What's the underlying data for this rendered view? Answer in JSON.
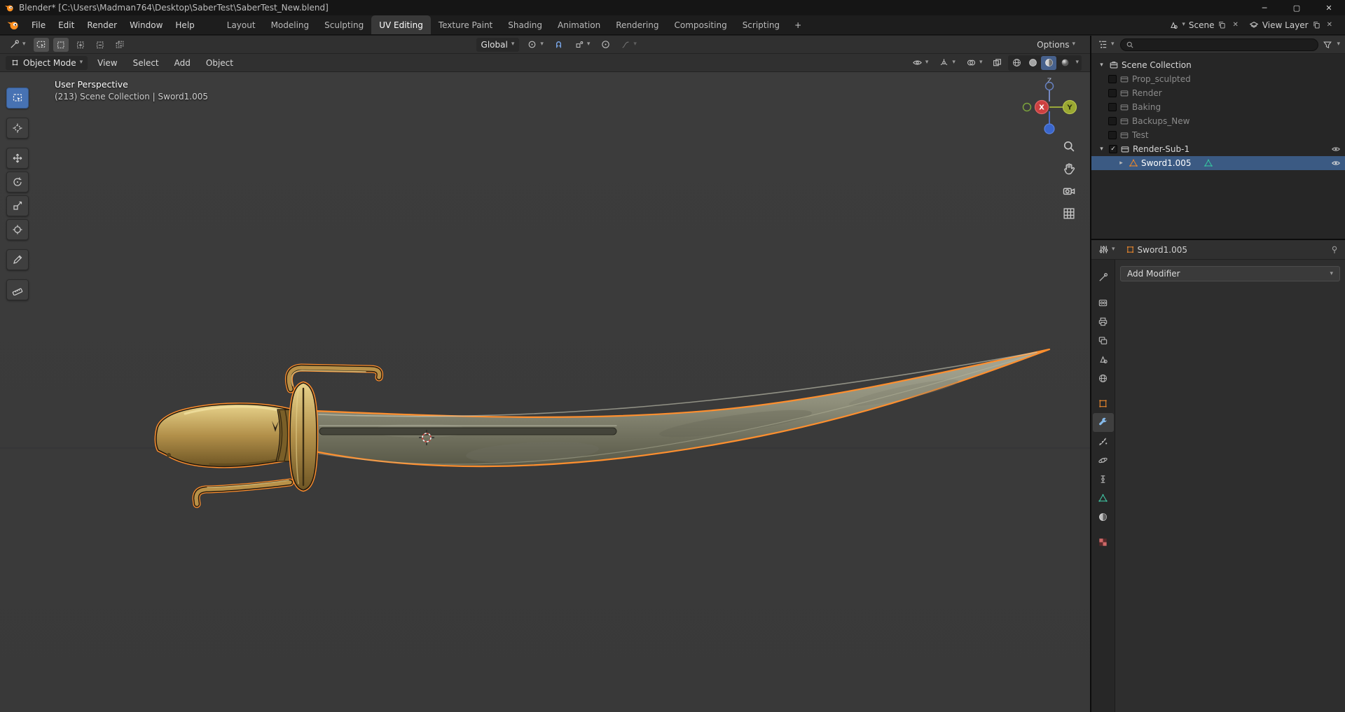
{
  "window": {
    "title": "Blender* [C:\\Users\\Madman764\\Desktop\\SaberTest\\SaberTest_New.blend]",
    "controls": [
      "minimize",
      "maximize",
      "close"
    ]
  },
  "topbar": {
    "menus": [
      "File",
      "Edit",
      "Render",
      "Window",
      "Help"
    ],
    "workspaces": [
      "Layout",
      "Modeling",
      "Sculpting",
      "UV Editing",
      "Texture Paint",
      "Shading",
      "Animation",
      "Rendering",
      "Compositing",
      "Scripting"
    ],
    "active_workspace": "UV Editing",
    "new_workspace_label": "+",
    "scene_name": "Scene",
    "view_layer_name": "View Layer"
  },
  "tool_settings": {
    "options_label": "Options",
    "active_tool": "box-select",
    "select_modes": [
      "set",
      "extend",
      "subtract",
      "intersect"
    ]
  },
  "viewport_header": {
    "mode": "Object Mode",
    "menus": [
      "View",
      "Select",
      "Add",
      "Object"
    ],
    "orientation": "Global",
    "shading_modes": [
      "wireframe",
      "solid",
      "material-preview",
      "rendered"
    ],
    "active_shading": "material-preview"
  },
  "viewport": {
    "view_label": "User Perspective",
    "stats_label": "(213) Scene Collection | Sword1.005",
    "tools": [
      "box-select",
      "cursor",
      "move",
      "rotate",
      "scale",
      "transform",
      "annotate",
      "measure"
    ],
    "active_tool": "box-select",
    "gizmo_axes": {
      "x": "X",
      "y": "Y",
      "z": "Z"
    }
  },
  "outliner": {
    "root_label": "Scene Collection",
    "search_placeholder": "",
    "items": [
      {
        "name": "Prop_sculpted",
        "type": "collection",
        "checked": false
      },
      {
        "name": "Render",
        "type": "collection",
        "checked": false
      },
      {
        "name": "Baking",
        "type": "collection",
        "checked": false
      },
      {
        "name": "Backups_New",
        "type": "collection",
        "checked": false
      },
      {
        "name": "Test",
        "type": "collection",
        "checked": false
      },
      {
        "name": "Render-Sub-1",
        "type": "collection",
        "checked": true
      },
      {
        "name": "Sword1.005",
        "type": "mesh-object",
        "selected": true
      }
    ]
  },
  "properties": {
    "active_object": "Sword1.005",
    "add_modifier_label": "Add Modifier",
    "tabs": [
      "tool",
      "render",
      "output",
      "view-layer",
      "scene",
      "world",
      "object",
      "modifiers",
      "particles",
      "physics",
      "constraints",
      "object-data",
      "material",
      "texture"
    ],
    "active_tab": "modifiers"
  },
  "colors": {
    "selection_outline": "#ff8f2e",
    "accent": "#4772b3",
    "object_icon": "#e8862d",
    "mesh_data_icon": "#35c4a0"
  }
}
